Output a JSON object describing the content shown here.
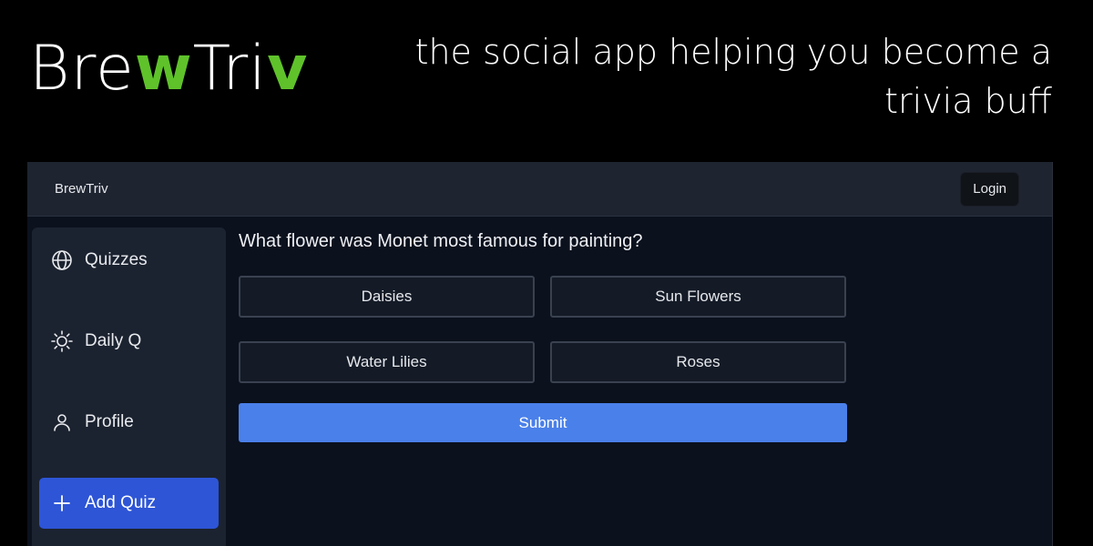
{
  "hero": {
    "logo_part1": "Bre",
    "logo_accent1": "w",
    "logo_part2": "Tri",
    "logo_accent2": "v",
    "tagline": "the social app helping you become a trivia buff"
  },
  "colors": {
    "accent_green": "#5fc22b",
    "active_nav": "#2d55d6",
    "submit": "#4a80ea"
  },
  "topbar": {
    "brand": "BrewTriv",
    "login_label": "Login"
  },
  "sidebar": {
    "items": [
      {
        "label": "Quizzes",
        "icon": "globe-icon"
      },
      {
        "label": "Daily Q",
        "icon": "sun-icon"
      },
      {
        "label": "Profile",
        "icon": "user-icon"
      },
      {
        "label": "Add Quiz",
        "icon": "plus-icon",
        "active": true
      }
    ]
  },
  "quiz": {
    "question": "What flower was Monet most famous for painting?",
    "answers": [
      "Daisies",
      "Sun Flowers",
      "Water Lilies",
      "Roses"
    ],
    "submit_label": "Submit"
  }
}
